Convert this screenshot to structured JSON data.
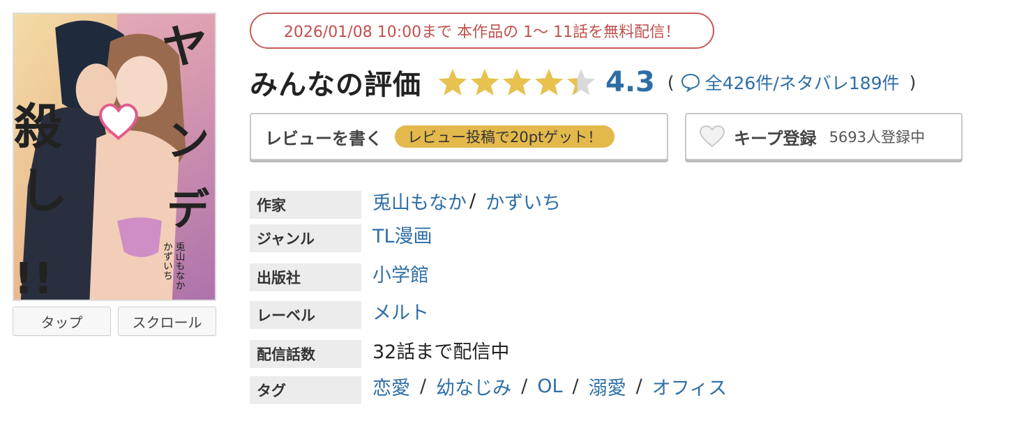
{
  "cover": {
    "title_chars": [
      "ヤ",
      "ン",
      "デ",
      "殺",
      "し",
      "!!"
    ],
    "author_credit": "兎山もなか",
    "artist_credit": "かずいち",
    "buttons": [
      "タップ",
      "スクロール"
    ]
  },
  "campaign": {
    "text": "2026/01/08 10:00まで 本作品の 1〜 11話を無料配信！"
  },
  "rating": {
    "title": "みんなの評価",
    "score": "4.3",
    "stars_value": 4.3,
    "stars_max": 5,
    "open_paren": "(",
    "count_text": "全426件/ネタバレ189件",
    "close_paren": ")"
  },
  "review_button": {
    "label": "レビューを書く",
    "badge": "レビュー投稿で20ptゲット！"
  },
  "keep_button": {
    "label": "キープ登録",
    "count": "5693人登録中"
  },
  "info": {
    "author": {
      "label": "作家",
      "values": [
        "兎山もなか",
        "かずいち"
      ],
      "separator": "/"
    },
    "genre": {
      "label": "ジャンル",
      "value": "TL漫画"
    },
    "publisher": {
      "label": "出版社",
      "value": "小学館"
    },
    "imprint": {
      "label": "レーベル",
      "value": "メルト"
    },
    "episodes": {
      "label": "配信話数",
      "value": "32話まで配信中"
    },
    "tags": {
      "label": "タグ",
      "values": [
        "恋愛",
        "幼なじみ",
        "OL",
        "溺愛",
        "オフィス"
      ],
      "separator": "/"
    }
  },
  "colors": {
    "link": "#2e6ea6",
    "campaign_border": "#c85a5a",
    "campaign_text": "#c0504d",
    "star": "#e7c24f",
    "badge": "#e3b94c",
    "label_bg": "#ececec"
  },
  "icons": {
    "star": "star-icon",
    "comment": "speech-bubble-icon",
    "keep": "heart-icon"
  }
}
